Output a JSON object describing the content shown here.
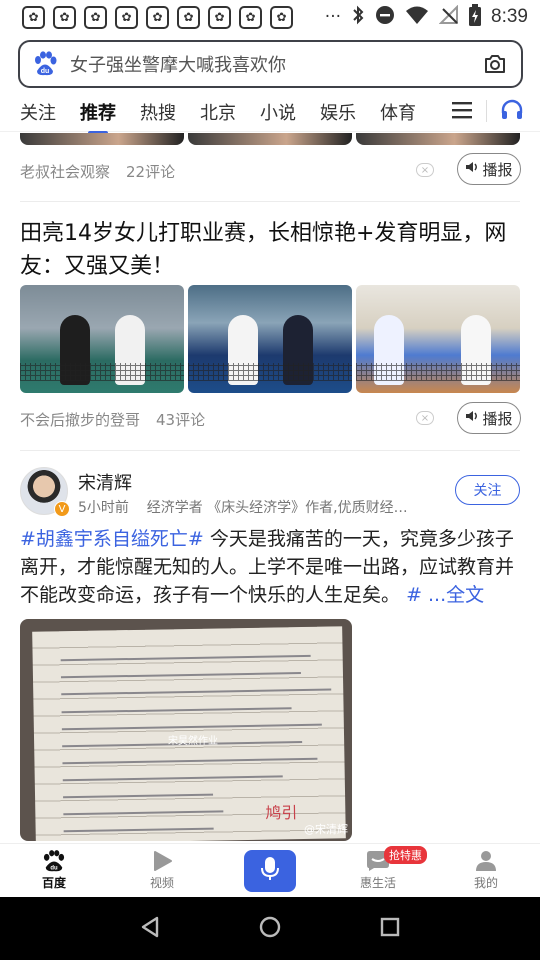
{
  "status_bar": {
    "paw_count": 9,
    "time": "8:39",
    "icons": [
      "more-dots-icon",
      "bluetooth-icon",
      "dnd-icon",
      "wifi-icon",
      "no-sim-icon",
      "battery-icon"
    ],
    "more": "···"
  },
  "search": {
    "placeholder": "女子强坐警摩大喊我喜欢你",
    "logo": "baidu-paw-icon",
    "camera": "camera-icon"
  },
  "tabs": [
    {
      "label": "关注"
    },
    {
      "label": "推荐",
      "active": true
    },
    {
      "label": "热搜"
    },
    {
      "label": "北京"
    },
    {
      "label": "小说"
    },
    {
      "label": "娱乐"
    },
    {
      "label": "体育"
    }
  ],
  "feed": {
    "item1": {
      "source": "老叔社会观察",
      "comments": "22评论",
      "play_label": "播报"
    },
    "item2": {
      "headline": "田亮14岁女儿打职业赛，长相惊艳+发育明显，网友：又强又美！",
      "source": "不会后撤步的登哥",
      "comments": "43评论",
      "play_label": "播报"
    },
    "item3": {
      "author": "宋清辉",
      "time": "5小时前",
      "desc": "经济学者 《床头经济学》作者,优质财经领...",
      "follow": "关注",
      "hashtag": "#胡鑫宇系自缢死亡#",
      "text": " 今天是我痛苦的一天，究竟多少孩子离开，才能惊醒无知的人。上学不是唯一出路，应试教育并不能改变命运，孩子有一个快乐的人生足矣。",
      "more": "# ...全文",
      "watermark": "宋昊然作业",
      "credit": "@宋清辉",
      "red_mark": "鸠引"
    }
  },
  "bottom_nav": [
    {
      "label": "百度",
      "icon": "baidu-paw-icon",
      "active": true
    },
    {
      "label": "视频",
      "icon": "video-play-icon"
    },
    {
      "label": "",
      "icon": "mic-icon"
    },
    {
      "label": "惠生活",
      "icon": "message-icon",
      "badge": "抢特惠"
    },
    {
      "label": "我的",
      "icon": "person-icon"
    }
  ],
  "colors": {
    "accent": "#3b63e0",
    "badge": "#e8353b",
    "verified": "#f29a1a"
  }
}
